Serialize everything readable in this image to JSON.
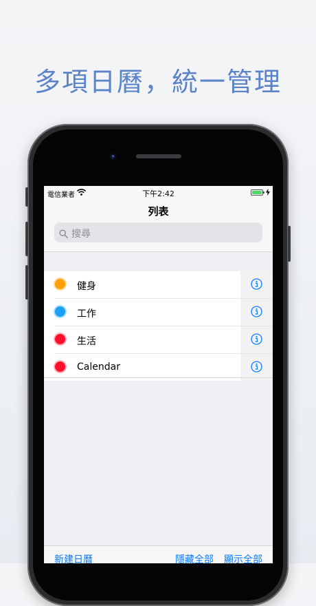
{
  "promo": {
    "headline": "多項日曆，統一管理"
  },
  "status_bar": {
    "carrier": "電信業者",
    "time": "下午2:42"
  },
  "nav": {
    "title": "列表"
  },
  "search": {
    "placeholder": "搜尋"
  },
  "calendars": [
    {
      "label": "健身",
      "color": "#ff9f0a",
      "ring": "#ffd79a"
    },
    {
      "label": "工作",
      "color": "#1ba1f3",
      "ring": "#a8dcfb"
    },
    {
      "label": "生活",
      "color": "#ff0f2b",
      "ring": "#ffb0b9"
    },
    {
      "label": "Calendar",
      "color": "#ff0f2b",
      "ring": "#ffb0b9"
    }
  ],
  "toolbar": {
    "new_calendar": "新建日曆",
    "hide_all": "隱藏全部",
    "show_all": "顯示全部"
  },
  "accent_color": "#0b7bff",
  "icons": [
    "wifi-icon",
    "battery-icon",
    "charging-icon",
    "search-icon",
    "info-icon"
  ]
}
